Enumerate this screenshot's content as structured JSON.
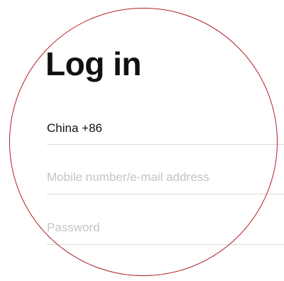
{
  "page": {
    "title": "Log in"
  },
  "form": {
    "country_code": "China +86",
    "account_placeholder": "Mobile number/e-mail address",
    "password_placeholder": "Password"
  },
  "colors": {
    "lens_ring": "#b01f24",
    "text": "#111111",
    "placeholder": "#c4c4c4",
    "divider": "#d9d9d9"
  }
}
